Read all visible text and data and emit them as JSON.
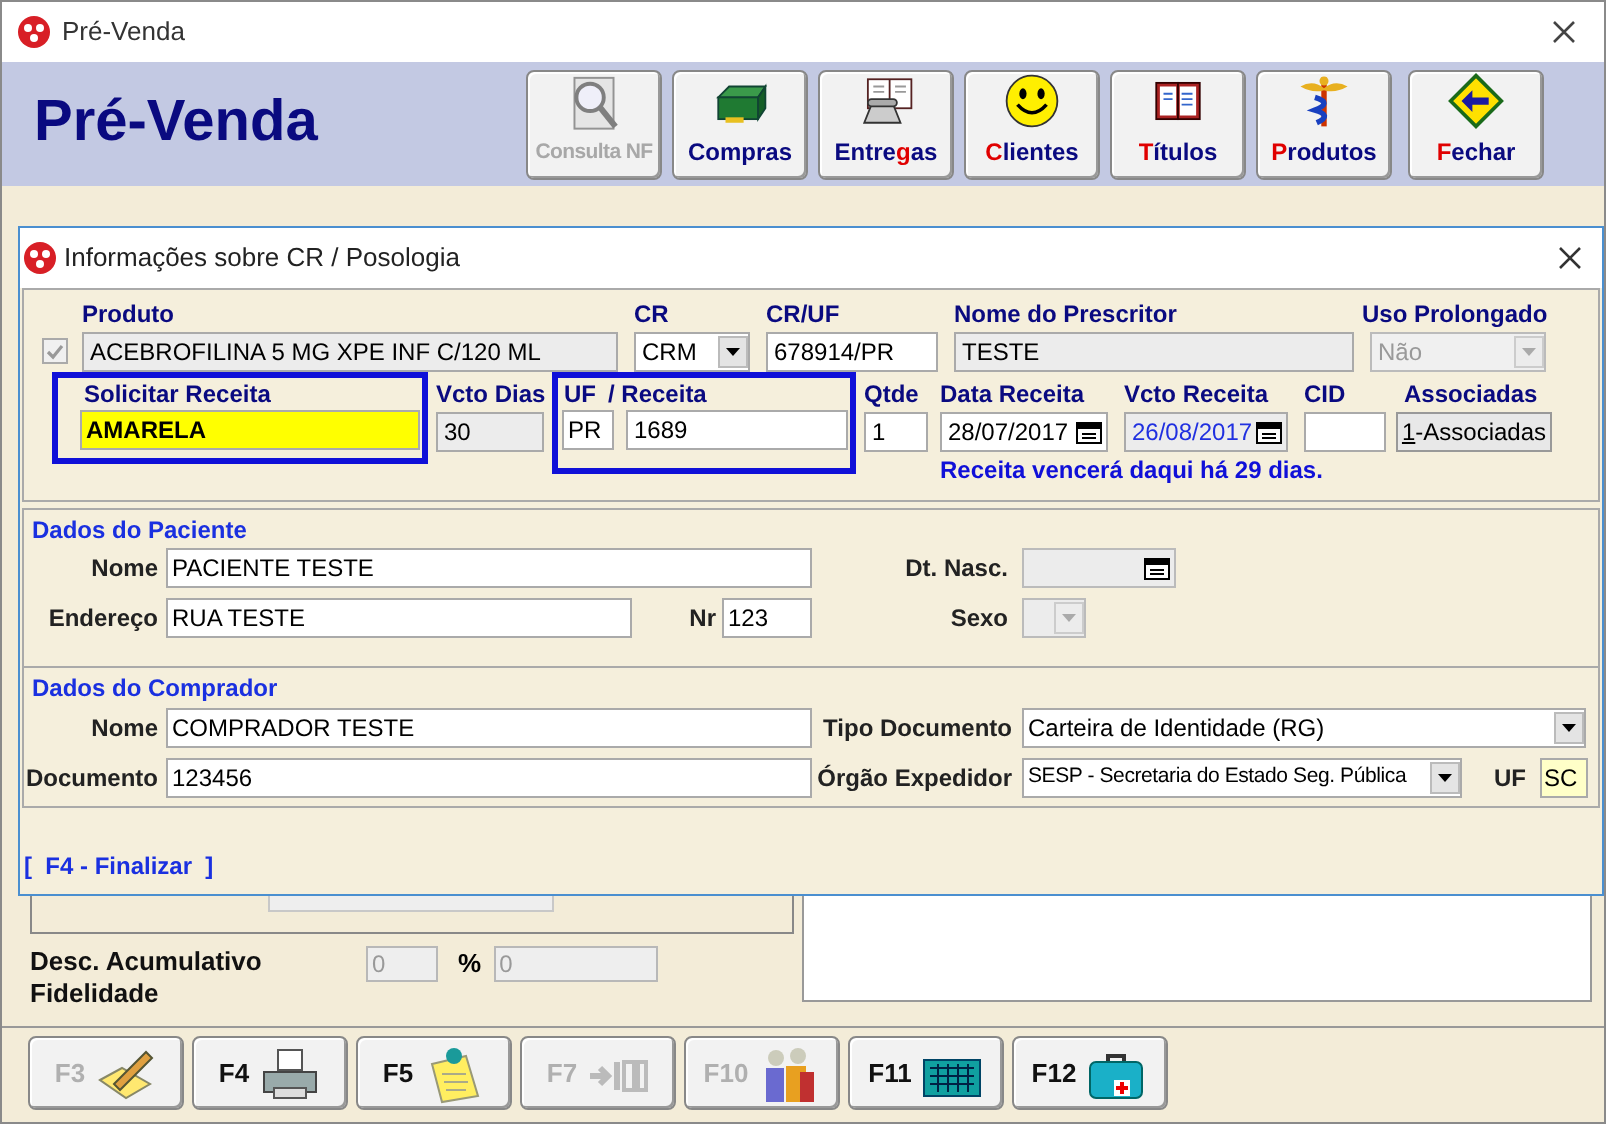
{
  "window": {
    "title": "Pré-Venda"
  },
  "header": {
    "title": "Pré-Venda",
    "buttons": [
      {
        "kind": "search",
        "pre": "Co",
        "key": "n",
        "post": "sulta NF",
        "disabled": true
      },
      {
        "kind": "cashbox",
        "pre": "Compras",
        "disabled": false
      },
      {
        "kind": "phonebook",
        "pre": "Entre",
        "key": "g",
        "post": "as",
        "disabled": false
      },
      {
        "kind": "smiley",
        "key": "C",
        "post": "lientes",
        "disabled": false
      },
      {
        "kind": "books",
        "key": "T",
        "post": "ítulos",
        "disabled": false
      },
      {
        "kind": "caduceus",
        "key": "P",
        "post": "rodutos",
        "disabled": false
      },
      {
        "kind": "back",
        "key": "F",
        "post": "echar",
        "disabled": false
      }
    ]
  },
  "dialog": {
    "title": "Informações sobre CR / Posologia",
    "produto": {
      "label": "Produto",
      "checked": true,
      "value": "ACEBROFILINA 5 MG XPE INF C/120 ML"
    },
    "cr": {
      "label": "CR",
      "value": "CRM"
    },
    "cr_uf": {
      "label": "CR/UF",
      "value": "678914/PR"
    },
    "prescritor": {
      "label": "Nome do Prescritor",
      "value": "TESTE"
    },
    "uso_prolongado": {
      "label": "Uso Prolongado",
      "value": "Não",
      "disabled": true
    },
    "solicitar_receita": {
      "label": "Solicitar Receita",
      "value": "AMARELA"
    },
    "vcto_dias": {
      "label": "Vcto Dias",
      "value": "30"
    },
    "uf_receita": {
      "label_uf": "UF",
      "label_receita": "/ Receita",
      "uf": "PR",
      "receita": "1689"
    },
    "qtde": {
      "label": "Qtde",
      "value": "1"
    },
    "data_receita": {
      "label": "Data Receita",
      "value": "28/07/2017"
    },
    "vcto_receita": {
      "label": "Vcto Receita",
      "value": "26/08/2017"
    },
    "cid": {
      "label": "CID"
    },
    "associadas": {
      "label": "Associadas",
      "button_key": "1",
      "button_post": "-Associadas"
    },
    "message": "Receita vencerá daqui há 29 dias.",
    "paciente": {
      "title": "Dados do Paciente",
      "nome_label": "Nome",
      "nome": "PACIENTE TESTE",
      "dt_nasc_label": "Dt. Nasc.",
      "endereco_label": "Endereço",
      "endereco": "RUA TESTE",
      "nr_label": "Nr",
      "nr": "123",
      "sexo_label": "Sexo"
    },
    "comprador": {
      "title": "Dados do Comprador",
      "nome_label": "Nome",
      "nome": "COMPRADOR TESTE",
      "tipo_label": "Tipo Documento",
      "tipo": "Carteira de Identidade (RG)",
      "documento_label": "Documento",
      "documento": "123456",
      "orgao_label": "Órgão Expedidor",
      "orgao": "SESP - Secretaria do Estado Seg. Pública",
      "uf_label": "UF",
      "uf": "SC"
    },
    "finalizar": "[  F4 - Finalizar  ]"
  },
  "desconto": {
    "label": "Desc. Acumulativo Fidelidade",
    "value_1": "0",
    "percent": "%",
    "value_2": "0"
  },
  "toolbar": [
    {
      "kind": "pencil",
      "key": "F3",
      "disabled": true
    },
    {
      "kind": "printer",
      "key": "F4",
      "disabled": false
    },
    {
      "kind": "note",
      "key": "F5",
      "disabled": false
    },
    {
      "kind": "numbers",
      "key": "F7",
      "disabled": true
    },
    {
      "kind": "people",
      "key": "F10",
      "disabled": true
    },
    {
      "kind": "calculator",
      "key": "F11",
      "disabled": false
    },
    {
      "kind": "firstaid",
      "key": "F12",
      "disabled": false
    }
  ]
}
